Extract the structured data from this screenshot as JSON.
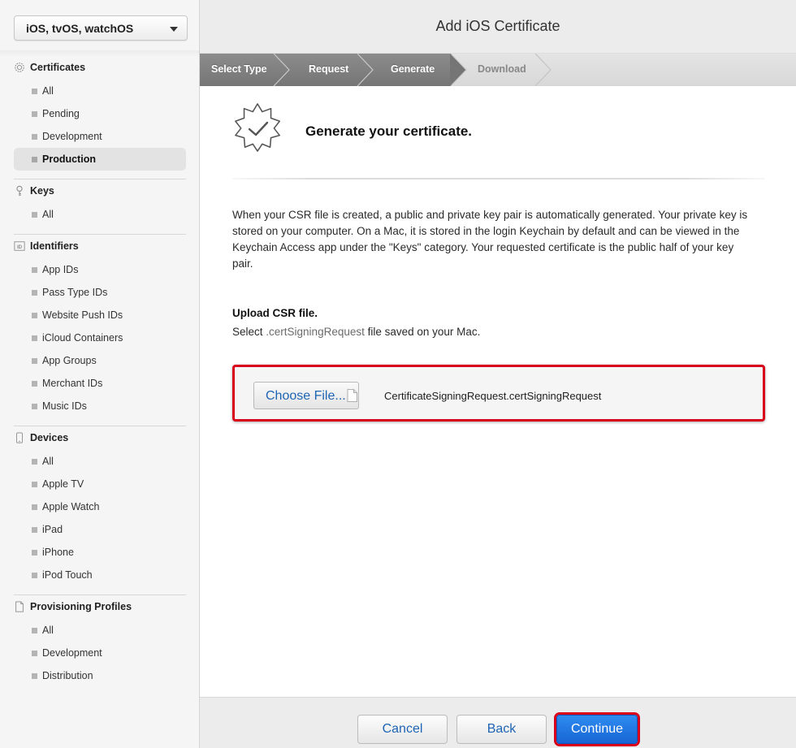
{
  "platform": {
    "selected": "iOS, tvOS, watchOS"
  },
  "sidebar": {
    "certificates": {
      "title": "Certificates",
      "items": [
        "All",
        "Pending",
        "Development",
        "Production"
      ]
    },
    "keys": {
      "title": "Keys",
      "items": [
        "All"
      ]
    },
    "identifiers": {
      "title": "Identifiers",
      "items": [
        "App IDs",
        "Pass Type IDs",
        "Website Push IDs",
        "iCloud Containers",
        "App Groups",
        "Merchant IDs",
        "Music IDs"
      ]
    },
    "devices": {
      "title": "Devices",
      "items": [
        "All",
        "Apple TV",
        "Apple Watch",
        "iPad",
        "iPhone",
        "iPod Touch"
      ]
    },
    "profiles": {
      "title": "Provisioning Profiles",
      "items": [
        "All",
        "Development",
        "Distribution"
      ]
    },
    "active_item": "Production"
  },
  "header": {
    "title": "Add iOS Certificate"
  },
  "steps": [
    "Select Type",
    "Request",
    "Generate",
    "Download"
  ],
  "content": {
    "heading": "Generate your certificate.",
    "description": "When your CSR file is created, a public and private key pair is automatically generated. Your private key is stored on your computer. On a Mac, it is stored in the login Keychain by default and can be viewed in the Keychain Access app under the \"Keys\" category. Your requested certificate is the public half of your key pair.",
    "upload_title": "Upload CSR file.",
    "upload_sub_prefix": "Select ",
    "upload_sub_ext": ".certSigningRequest",
    "upload_sub_suffix": " file saved on your Mac.",
    "choose_label": "Choose File...",
    "file_name": "CertificateSigningRequest.certSigningRequest"
  },
  "footer": {
    "cancel": "Cancel",
    "back": "Back",
    "continue": "Continue"
  },
  "colors": {
    "accent": "#1e64b4",
    "primary": "#1765d4",
    "highlight": "#d9001b"
  }
}
